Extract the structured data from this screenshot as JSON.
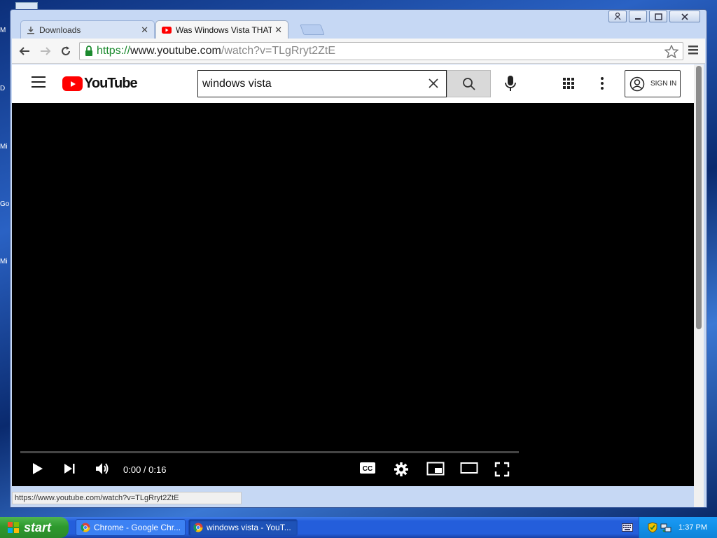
{
  "desktop": {
    "icon_labels": [
      "M",
      "D",
      "Mi",
      "Go",
      "Mi"
    ]
  },
  "browser": {
    "tabs": [
      {
        "title": "Downloads",
        "icon": "download-icon"
      },
      {
        "title": "Was Windows Vista THAT ba",
        "icon": "youtube-favicon"
      }
    ],
    "url": {
      "scheme": "https://",
      "host": "www.youtube.com",
      "path": "/watch?v=TLgRryt2ZtE"
    },
    "status_url": "https://www.youtube.com/watch?v=TLgRryt2ZtE"
  },
  "youtube": {
    "logo_text": "YouTube",
    "search_query": "windows vista",
    "sign_in": "SIGN IN"
  },
  "player": {
    "time_display": "0:00 / 0:16",
    "progress": 0
  },
  "taskbar": {
    "start_label": "start",
    "tasks": [
      {
        "label": "Chrome - Google Chr..."
      },
      {
        "label": "windows vista - YouT..."
      }
    ],
    "clock": "1:37 PM"
  },
  "colors": {
    "youtube_red": "#ff0000",
    "url_scheme_green": "#1b8a2e",
    "xp_taskbar_blue": "#245edb",
    "xp_start_green": "#2e9a2e"
  }
}
